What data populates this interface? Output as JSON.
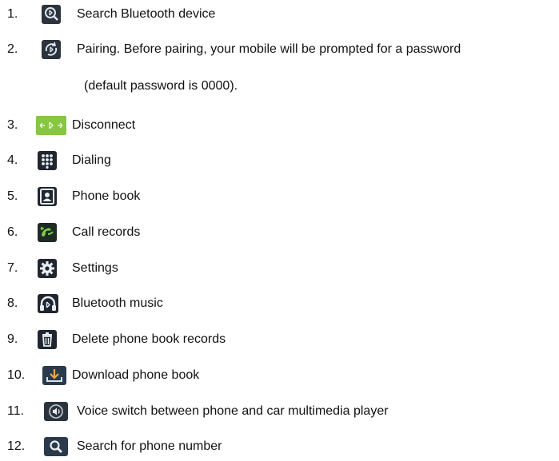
{
  "items": [
    {
      "num": "1.",
      "icon": "bluetooth-search-icon",
      "label": "Search Bluetooth device"
    },
    {
      "num": "2.",
      "icon": "bluetooth-pairing-icon",
      "label": "Pairing. Before pairing, your mobile will be prompted for a password",
      "cont": "(default password is 0000)."
    },
    {
      "num": "3.",
      "icon": "bluetooth-disconnect-icon",
      "label": "Disconnect"
    },
    {
      "num": "4.",
      "icon": "dialpad-icon",
      "label": "Dialing"
    },
    {
      "num": "5.",
      "icon": "contacts-icon",
      "label": "Phone book"
    },
    {
      "num": "6.",
      "icon": "call-log-icon",
      "label": "Call records"
    },
    {
      "num": "7.",
      "icon": "gear-icon",
      "label": "Settings"
    },
    {
      "num": "8.",
      "icon": "headphones-bluetooth-icon",
      "label": "Bluetooth music"
    },
    {
      "num": "9.",
      "icon": "trash-icon",
      "label": "Delete phone book records"
    },
    {
      "num": "10.",
      "icon": "download-icon",
      "label": "Download phone book"
    },
    {
      "num": "11.",
      "icon": "voice-switch-icon",
      "label": "Voice switch between phone and car multimedia player"
    },
    {
      "num": "12.",
      "icon": "search-icon",
      "label": "Search for phone number"
    }
  ],
  "colors": {
    "icon_dark": "#1e2530",
    "icon_green": "#7cc23a",
    "text": "#111111"
  }
}
